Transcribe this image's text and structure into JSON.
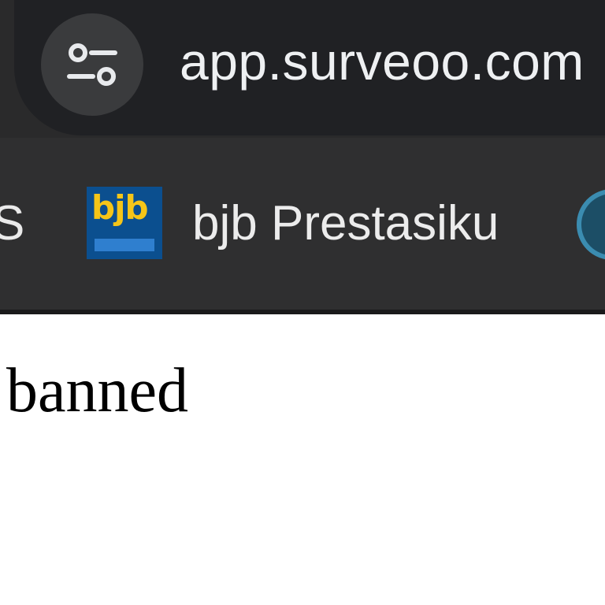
{
  "address_bar": {
    "url": "app.surveoo.com"
  },
  "bookmarks": {
    "partial_left_label": "S",
    "items": [
      {
        "label": "bjb Prestasiku",
        "favicon_text": "bjb",
        "icon": "bjb-favicon"
      }
    ]
  },
  "page": {
    "body_text": "banned"
  },
  "colors": {
    "toolbar_bg": "#2a2a2b",
    "omnibox_bg": "#202124",
    "bookmarks_bg": "#2f2f30",
    "url_text": "#eef0f2",
    "favicon_bg": "#0b4f8f",
    "favicon_text": "#f5c518",
    "page_bg": "#ffffff",
    "page_text": "#000000"
  }
}
